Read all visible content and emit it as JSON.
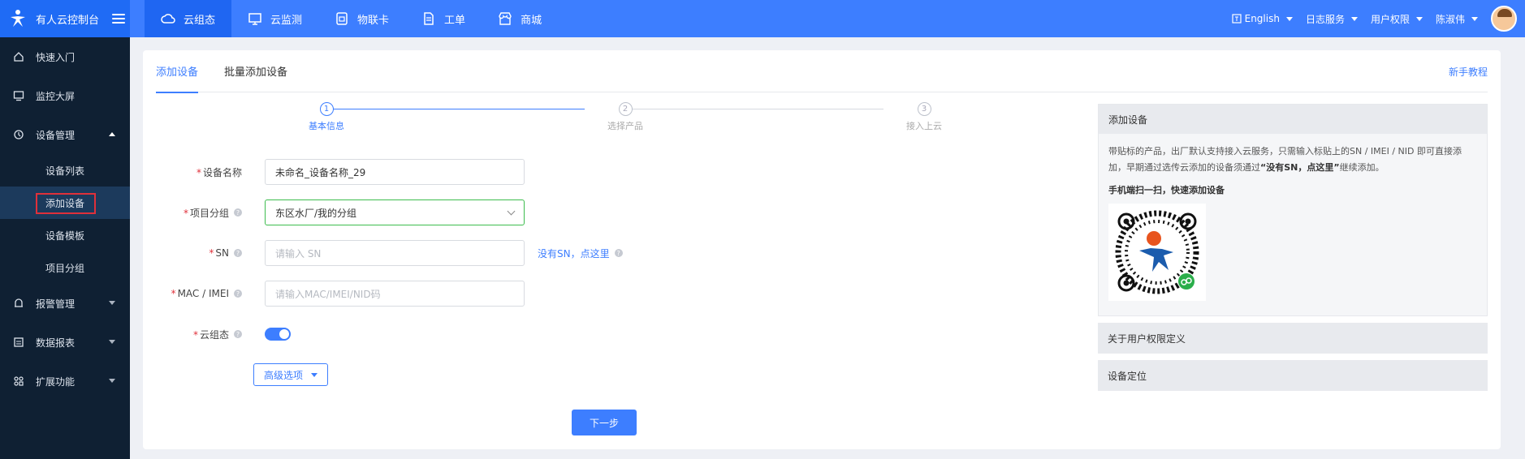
{
  "brand": {
    "title": "有人云控制台"
  },
  "nav_tabs": [
    {
      "label": "云组态",
      "icon": "cloud-icon",
      "active": true
    },
    {
      "label": "云监测",
      "icon": "monitor-icon",
      "active": false
    },
    {
      "label": "物联卡",
      "icon": "sim-card-icon",
      "active": false
    },
    {
      "label": "工单",
      "icon": "document-icon",
      "active": false
    },
    {
      "label": "商城",
      "icon": "shop-icon",
      "active": false
    }
  ],
  "top_right": {
    "language": "English",
    "logs": "日志服务",
    "permissions": "用户权限",
    "user": "陈淑伟"
  },
  "sidebar": {
    "items": [
      {
        "label": "快速入门",
        "icon": "home-icon"
      },
      {
        "label": "监控大屏",
        "icon": "screen-icon"
      },
      {
        "label": "设备管理",
        "icon": "device-icon"
      },
      {
        "label": "报警管理",
        "icon": "alarm-icon"
      },
      {
        "label": "数据报表",
        "icon": "report-icon"
      },
      {
        "label": "扩展功能",
        "icon": "extension-icon"
      }
    ],
    "sub_items": [
      {
        "label": "设备列表"
      },
      {
        "label": "添加设备",
        "active": true
      },
      {
        "label": "设备模板"
      },
      {
        "label": "项目分组"
      }
    ]
  },
  "tabs": {
    "add": "添加设备",
    "batch": "批量添加设备",
    "guide": "新手教程"
  },
  "steps": [
    {
      "num": "1",
      "label": "基本信息"
    },
    {
      "num": "2",
      "label": "选择产品"
    },
    {
      "num": "3",
      "label": "接入上云"
    }
  ],
  "form": {
    "name_label": "设备名称",
    "name_value": "未命名_设备名称_29",
    "group_label": "项目分组",
    "group_value": "东区水厂/我的分组",
    "sn_label": "SN",
    "sn_placeholder": "请输入 SN",
    "sn_hint": "没有SN，点这里",
    "mac_label": "MAC / IMEI",
    "mac_placeholder": "请输入MAC/IMEI/NID码",
    "cloud_label": "云组态",
    "cloud_on": true,
    "advanced": "高级选项",
    "next": "下一步"
  },
  "right_panel": {
    "title": "添加设备",
    "desc_1": "带贴标的产品，出厂默认支持接入云服务，只需输入标贴上的SN / IMEI / NID 即可直接添加，早期通过选传云添加的设备须通过",
    "desc_bold": "“没有SN，点这里”",
    "desc_2": "继续添加。",
    "scan_hint": "手机端扫一扫，快速添加设备",
    "collapse_1": "关于用户权限定义",
    "collapse_2": "设备定位"
  },
  "colors": {
    "primary": "#3d7eff",
    "sidebar_bg": "#0f2033",
    "highlight": "#e0303a",
    "select_border": "#3dbc4e"
  }
}
